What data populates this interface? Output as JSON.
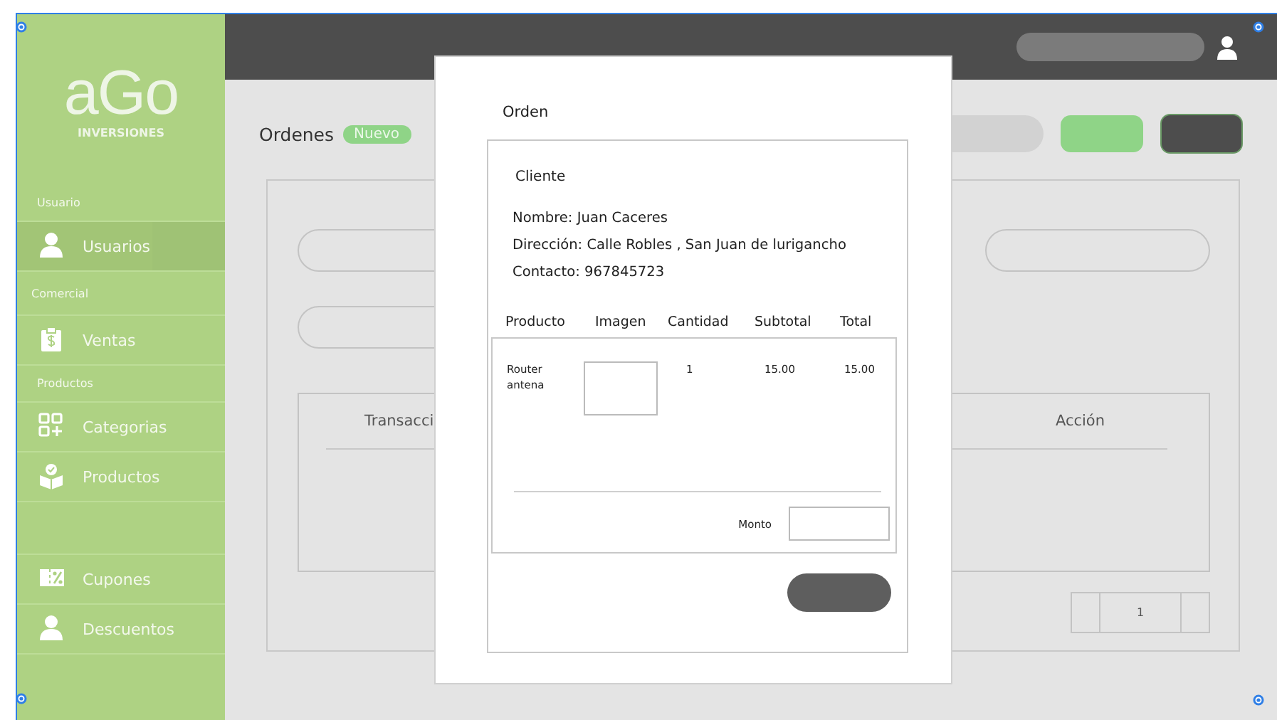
{
  "sidebar": {
    "logo": {
      "mark": "aGo",
      "subtitle": "INVERSIONES"
    },
    "groups": [
      {
        "title": "Usuario",
        "items": [
          {
            "label": "Usuarios",
            "selected": true
          }
        ]
      },
      {
        "title": "Comercial",
        "items": [
          {
            "label": "Ventas",
            "selected": false
          }
        ]
      },
      {
        "title": "Productos",
        "items": [
          {
            "label": "Categorias",
            "selected": false
          },
          {
            "label": "Productos",
            "selected": false
          }
        ]
      },
      {
        "items": [
          {
            "label": "Cupones",
            "selected": false
          },
          {
            "label": "Descuentos",
            "selected": false
          }
        ]
      }
    ]
  },
  "page": {
    "title": "Ordenes",
    "badge": "Nuevo",
    "table": {
      "columns": [
        "Transacci",
        "Acción"
      ]
    },
    "pager": {
      "page": "1"
    }
  },
  "modal": {
    "title": "Orden",
    "section": "Cliente",
    "details": [
      "Nombre: Juan Caceres",
      "Dirección: Calle Robles , San Juan de lurigancho",
      "Contacto: 967845723"
    ],
    "columns": [
      "Producto",
      "Imagen",
      "Cantidad",
      "Subtotal",
      "Total"
    ],
    "rows": [
      {
        "product": "Router antena",
        "quantity": "1",
        "subtotal": "15.00",
        "total": "15.00"
      }
    ],
    "amount_label": "Monto"
  }
}
